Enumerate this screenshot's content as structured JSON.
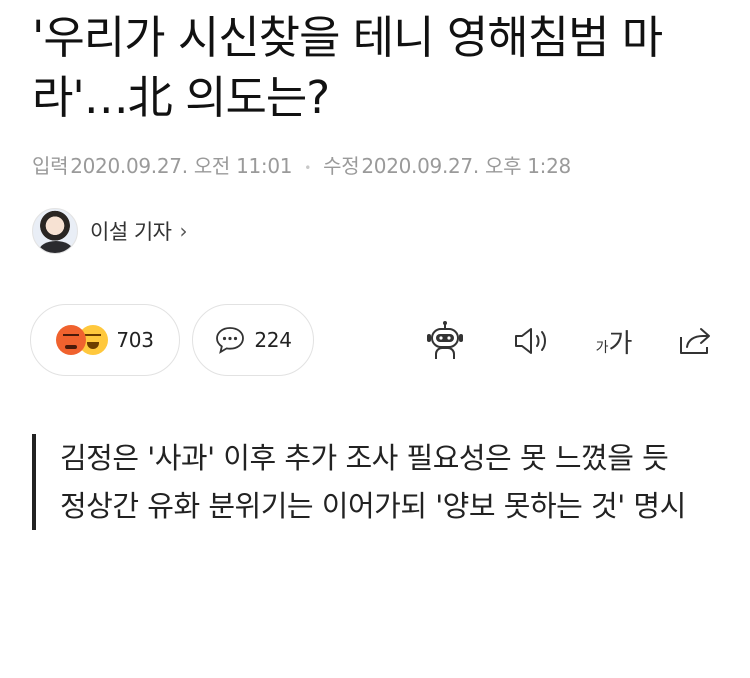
{
  "article": {
    "title": "'우리가 시신찾을 테니 영해침범 마라'…北 의도는?",
    "published_label": "입력",
    "published_time": "2020.09.27. 오전 11:01",
    "modified_label": "수정",
    "modified_time": "2020.09.27. 오후 1:28"
  },
  "author": {
    "name": "이설 기자",
    "chevron": "›"
  },
  "engagement": {
    "reaction_count": "703",
    "comment_count": "224",
    "reaction_icons": [
      "angry-emoji-icon",
      "laughing-emoji-icon"
    ],
    "comment_icon": "speech-bubble-icon"
  },
  "toolbar": {
    "icons": [
      "robot-summary-icon",
      "speaker-icon",
      "font-size-icon",
      "share-icon"
    ],
    "font_small": "가",
    "font_large": "가"
  },
  "summary": {
    "lines": [
      "김정은 '사과' 이후 추가 조사 필요성은 못 느꼈을 듯",
      "정상간 유화 분위기는 이어가되 '양보 못하는 것' 명시"
    ]
  },
  "colors": {
    "angry": "#f0622e",
    "laugh": "#ffc83d",
    "meta_text": "#9a9a9a",
    "summary_bar": "#222222"
  }
}
